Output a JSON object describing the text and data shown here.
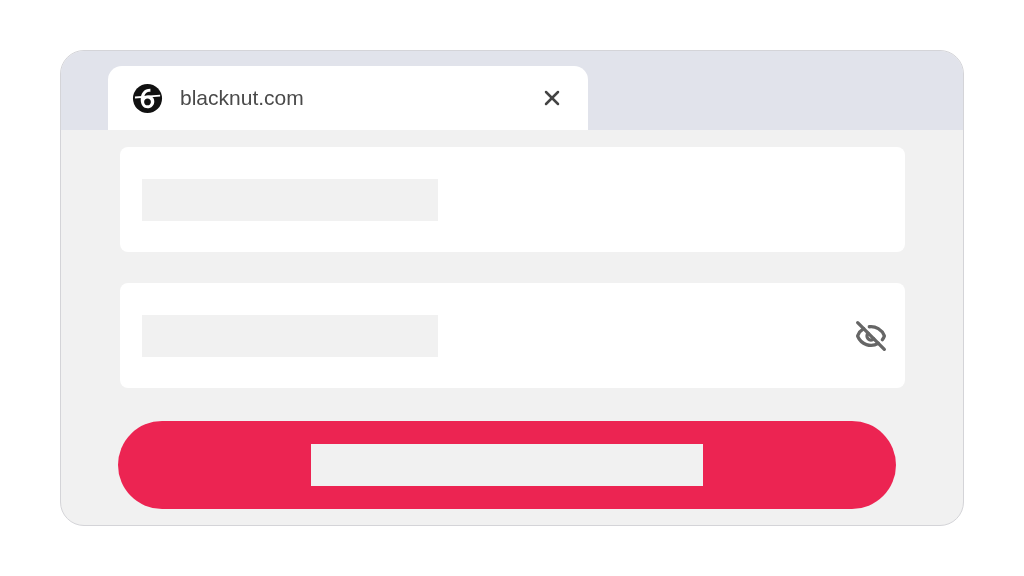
{
  "tab": {
    "title": "blacknut.com"
  },
  "fields": [
    {
      "kind": "text"
    },
    {
      "kind": "password",
      "revealed": false
    }
  ]
}
